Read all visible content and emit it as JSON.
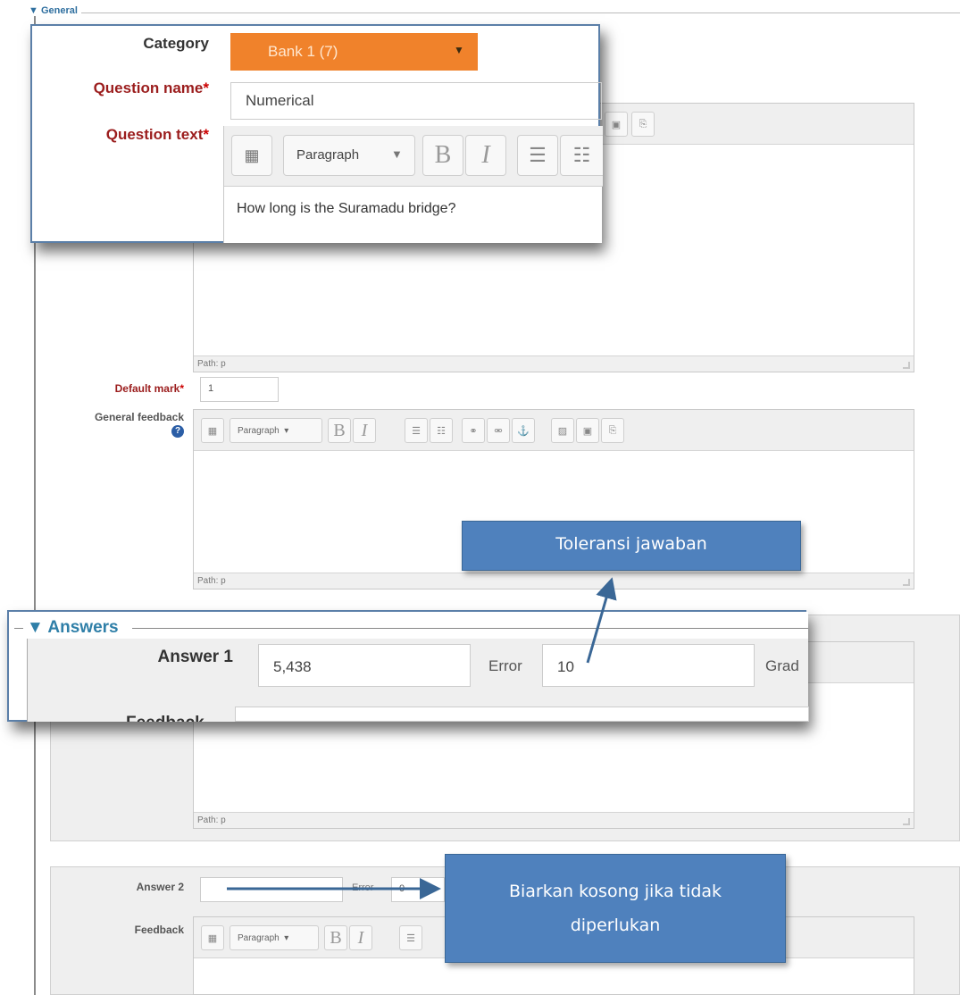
{
  "general": {
    "legend": "General",
    "category_label": "Category",
    "category_value": "Bank 1 (7)",
    "question_name_label": "Question name",
    "question_name_value": "Numerical",
    "question_text_label": "Question text",
    "question_text_value": "How long is the Suramadu bridge?",
    "required_marker": "*",
    "editor_format": "Paragraph",
    "path_label": "Path: p",
    "default_mark_label": "Default mark",
    "default_mark_value": "1",
    "general_feedback_label": "General feedback",
    "help_icon_text": "?"
  },
  "answers": {
    "legend": "Answers",
    "answer1_label": "Answer 1",
    "answer1_value": "5,438",
    "error_label": "Error",
    "error1_value": "10",
    "grade_label": "Grad",
    "feedback_label": "Feedback",
    "answer2_label": "Answer 2",
    "error2_label": "Error",
    "error2_value": "0"
  },
  "editor": {
    "bold": "B",
    "italic": "I",
    "format": "Paragraph"
  },
  "callouts": {
    "tolerance": "Toleransi jawaban",
    "leave_empty_line1": "Biarkan kosong jika tidak",
    "leave_empty_line2": "diperlukan"
  },
  "colors": {
    "category_select": "#f0822b",
    "callout_fill": "#4f81bd",
    "label_red": "#9b1d1d"
  }
}
